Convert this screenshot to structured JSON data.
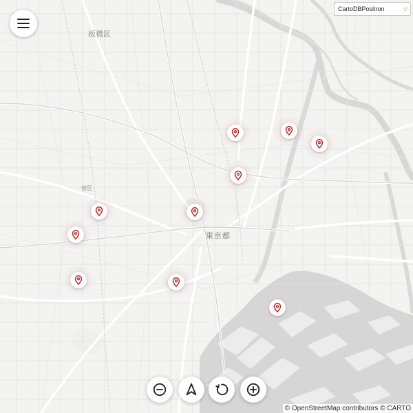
{
  "map": {
    "basemap": "CartoDBPositron",
    "colors": {
      "land": "#f3f3f2",
      "water": "#d6d6d6",
      "road_major": "#ffffff",
      "road_minor": "#e4e4e4",
      "park": "#e9ece7",
      "marker": "#b32a2a",
      "halo": "#e5bcbc"
    },
    "labels": {
      "itabashi": "板橋区",
      "ku": "宿区",
      "tokyo": "東京都"
    },
    "markers": [
      {
        "name": "marker-1",
        "icon": "map-pin-icon"
      },
      {
        "name": "marker-2",
        "icon": "map-pin-icon"
      },
      {
        "name": "marker-3",
        "icon": "map-pin-icon"
      },
      {
        "name": "marker-4",
        "icon": "map-pin-icon"
      },
      {
        "name": "marker-5",
        "icon": "map-pin-icon"
      },
      {
        "name": "marker-6",
        "icon": "map-pin-icon"
      },
      {
        "name": "marker-7",
        "icon": "map-pin-icon"
      },
      {
        "name": "marker-8",
        "icon": "map-pin-icon"
      },
      {
        "name": "marker-9",
        "icon": "map-pin-icon"
      },
      {
        "name": "marker-10",
        "icon": "map-pin-icon"
      },
      {
        "name": "marker-11",
        "icon": "map-pin-icon"
      }
    ]
  },
  "ui": {
    "menu_icon": "hamburger-menu-icon",
    "layer_selector": {
      "value": "CartoDBPositron",
      "icon": "chevron-down-icon"
    },
    "controls": {
      "zoom_out_icon": "minus-circle-icon",
      "north_icon": "navigation-arrow-icon",
      "rotate_icon": "rotate-icon",
      "zoom_in_icon": "plus-circle-icon"
    }
  },
  "attribution": {
    "prefix": "©",
    "text": "OpenStreetMap contributors © CARTO"
  }
}
